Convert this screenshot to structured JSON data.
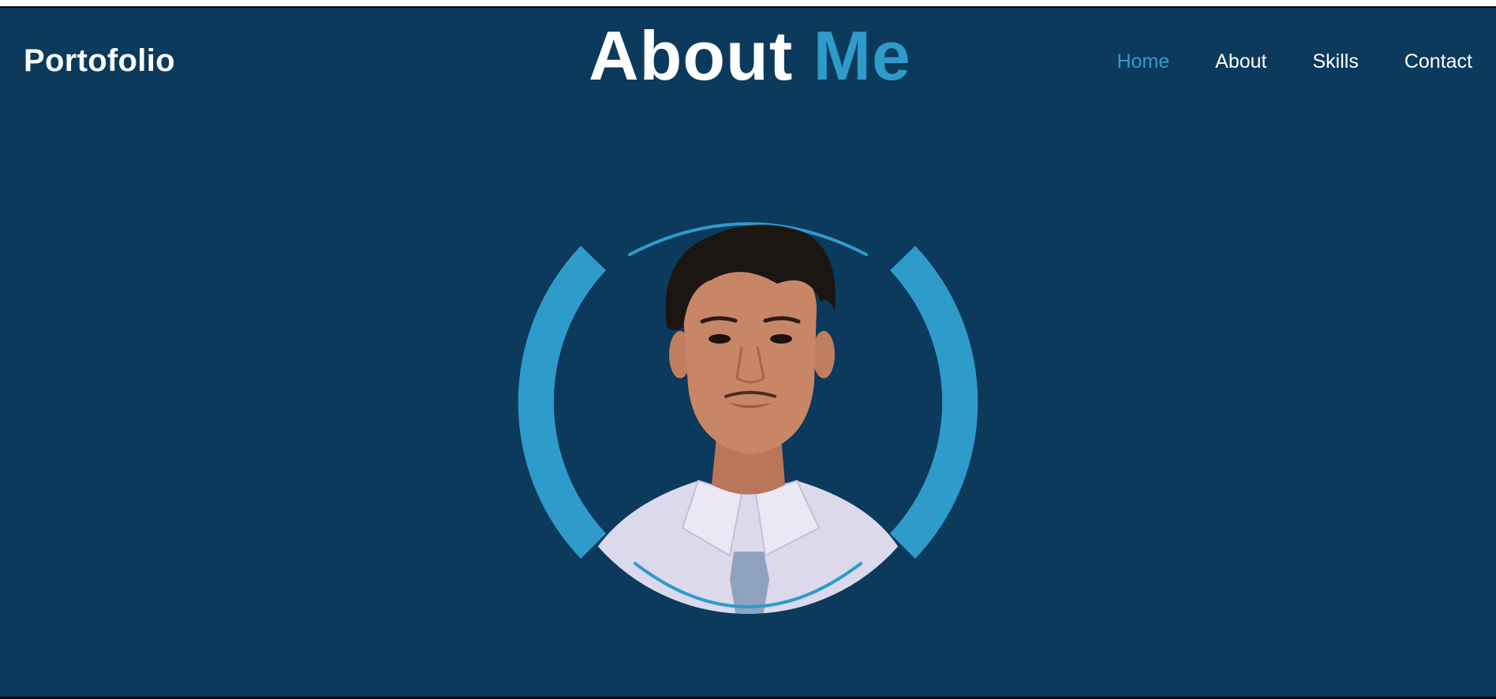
{
  "header": {
    "logo": "Portofolio",
    "title_main": "About",
    "title_accent": "Me"
  },
  "nav": {
    "items": [
      {
        "label": "Home",
        "active": true
      },
      {
        "label": "About",
        "active": false
      },
      {
        "label": "Skills",
        "active": false
      },
      {
        "label": "Contact",
        "active": false
      }
    ]
  },
  "colors": {
    "background": "#0b3a5c",
    "accent": "#2e9bca",
    "text": "#ffffff"
  },
  "profile": {
    "image": "profile-photo"
  }
}
